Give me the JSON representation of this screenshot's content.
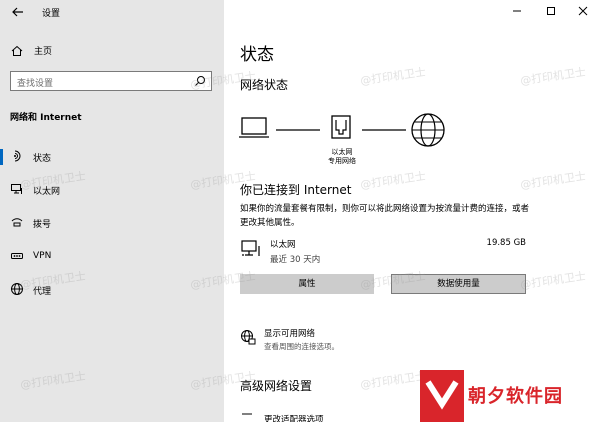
{
  "window": {
    "title": "设置"
  },
  "sidebar": {
    "home_label": "主页",
    "search_placeholder": "查找设置",
    "section_title": "网络和 Internet",
    "items": [
      {
        "label": "状态",
        "icon": "status-icon",
        "active": true
      },
      {
        "label": "以太网",
        "icon": "ethernet-icon"
      },
      {
        "label": "拨号",
        "icon": "dialup-icon"
      },
      {
        "label": "VPN",
        "icon": "vpn-icon"
      },
      {
        "label": "代理",
        "icon": "globe-icon"
      }
    ]
  },
  "main": {
    "page_title": "状态",
    "network_status_heading": "网络状态",
    "diagram_caption_line1": "以太网",
    "diagram_caption_line2": "专用网络",
    "connected_title": "你已连接到 Internet",
    "connected_desc": "如果你的流量套餐有限制，则你可以将此网络设置为按流量计费的连接，或者更改其他属性。",
    "adapter": {
      "name": "以太网",
      "time": "最近 30 天内",
      "usage": "19.85 GB"
    },
    "buttons": {
      "properties": "属性",
      "data_usage": "数据使用量"
    },
    "show_networks": {
      "title": "显示可用网络",
      "desc": "查看周围的连接选项。"
    },
    "advanced_heading": "高级网络设置",
    "cut_item": "更改适配器选项"
  },
  "watermark": {
    "text": "@打印机卫士"
  },
  "logo": {
    "text": "朝夕软件园"
  },
  "colors": {
    "accent": "#0067c0",
    "logo_red": "#d9252b",
    "sidebar_bg": "#e6e6e6"
  }
}
